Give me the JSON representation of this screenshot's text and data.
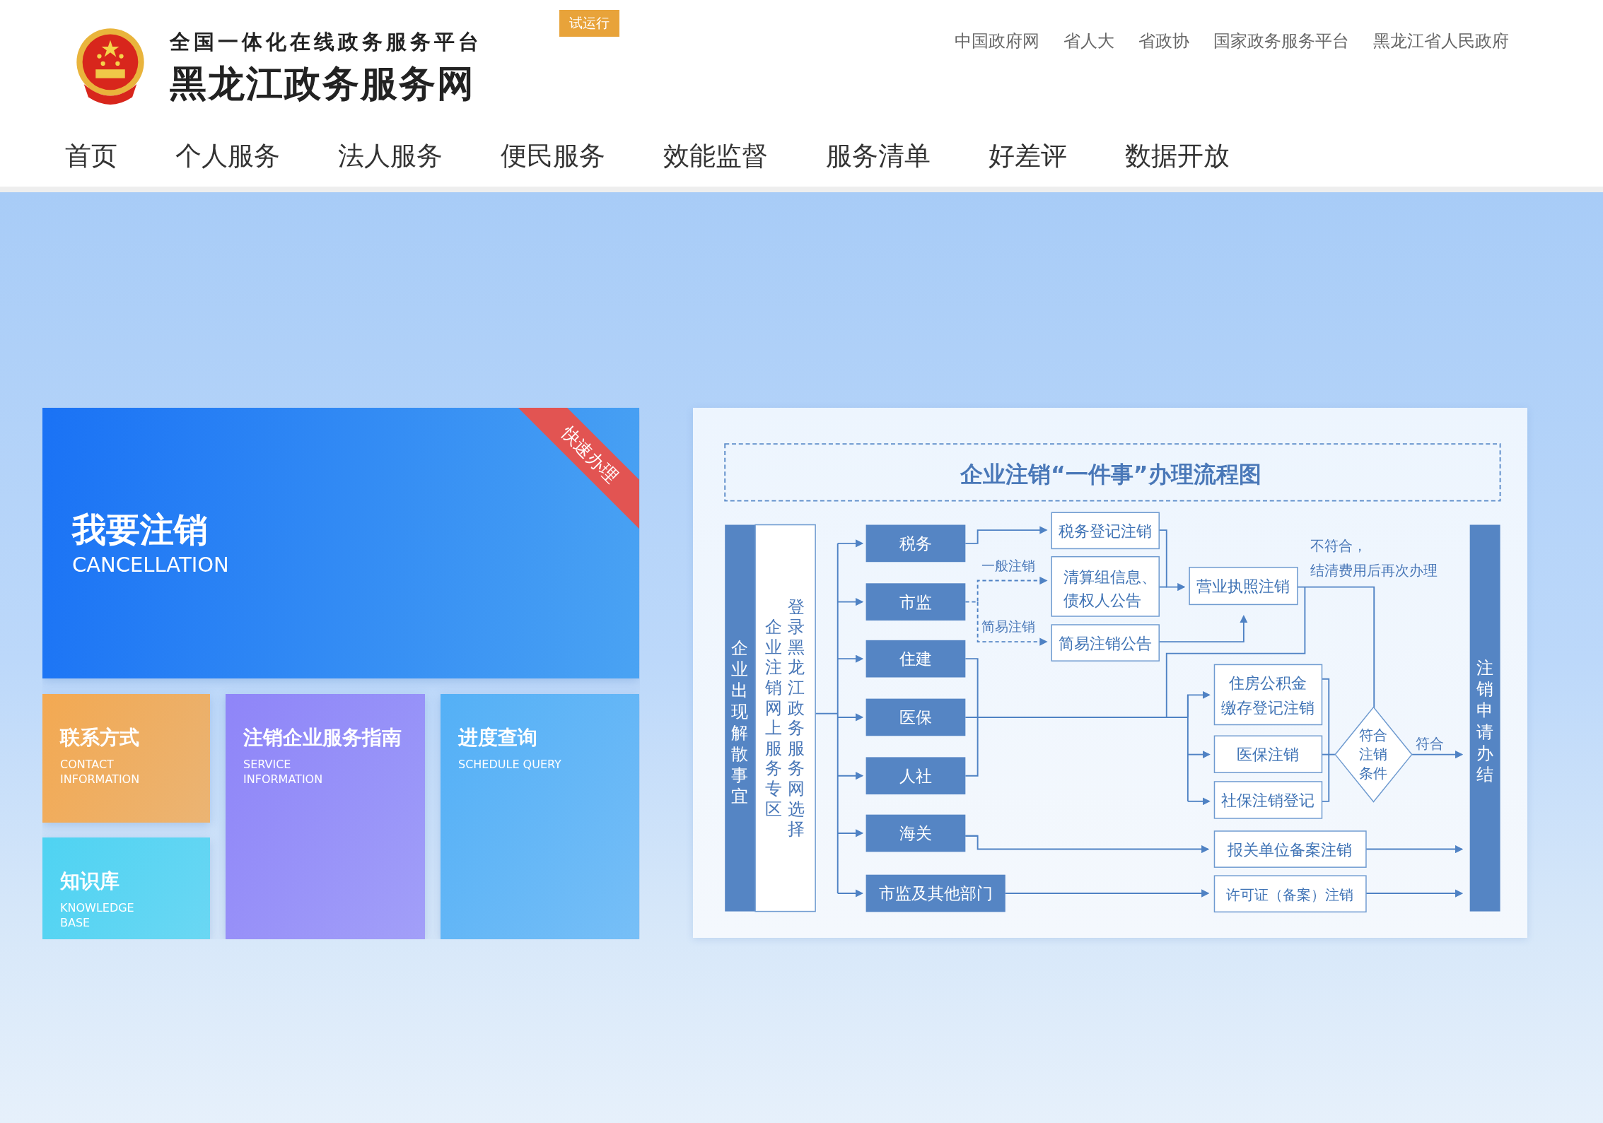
{
  "header": {
    "subtitle": "全国一体化在线政务服务平台",
    "title": "黑龙江政务服务网",
    "badge": "试运行",
    "links": [
      "中国政府网",
      "省人大",
      "省政协",
      "国家政务服务平台",
      "黑龙江省人民政府"
    ]
  },
  "nav": [
    "首页",
    "个人服务",
    "法人服务",
    "便民服务",
    "效能监督",
    "服务清单",
    "好差评",
    "数据开放"
  ],
  "cards": [
    {
      "kind": "feature",
      "title": "我要注销",
      "subtitle": [
        "CANCELLATION"
      ],
      "ribbon": "快速办理",
      "color": "#1a72f5"
    },
    {
      "kind": "tile",
      "title": "联系方式",
      "subtitle": [
        "CONTACT",
        "INFORMATION"
      ],
      "color": "#f3a952"
    },
    {
      "kind": "tall",
      "title": "注销企业服务指南",
      "subtitle": [
        "SERVICE",
        "INFORMATION"
      ],
      "color": "#8f85f8"
    },
    {
      "kind": "tall",
      "title": "进度查询",
      "subtitle": [
        "SCHEDULE QUERY"
      ],
      "color": "#54b0f6"
    },
    {
      "kind": "tile",
      "title": "知识库",
      "subtitle": [
        "KNOWLEDGE",
        "BASE"
      ],
      "color": "#4fd3f2"
    }
  ],
  "flowchart": {
    "title": "企业注销“一件事”办理流程图",
    "start": "企业出现解散事宜",
    "entry": [
      "企业注销网上服务专区",
      "登录黑龙江政务服务网选择"
    ],
    "departments": [
      "税务",
      "市监",
      "住建",
      "医保",
      "人社",
      "海关",
      "市监及其他部门"
    ],
    "tax_result": "税务登记注销",
    "general_label": "一般注销",
    "simple_label": "简易注销",
    "liquidation": [
      "清算组信息、",
      "债权人公告"
    ],
    "simple_notice": "简易注销公告",
    "license": "营业执照注销",
    "reject_label": [
      "不符合，",
      "结清费用后再次办理"
    ],
    "social": [
      [
        "住房公积金",
        "缴存登记注销"
      ],
      [
        "医保注销"
      ],
      [
        "社保注销登记"
      ]
    ],
    "condition": [
      "符合",
      "注销",
      "条件"
    ],
    "pass_label": "符合",
    "customs_result": "报关单位备案注销",
    "permit_result": "许可证（备案）注销",
    "end": "注销申请办结"
  }
}
